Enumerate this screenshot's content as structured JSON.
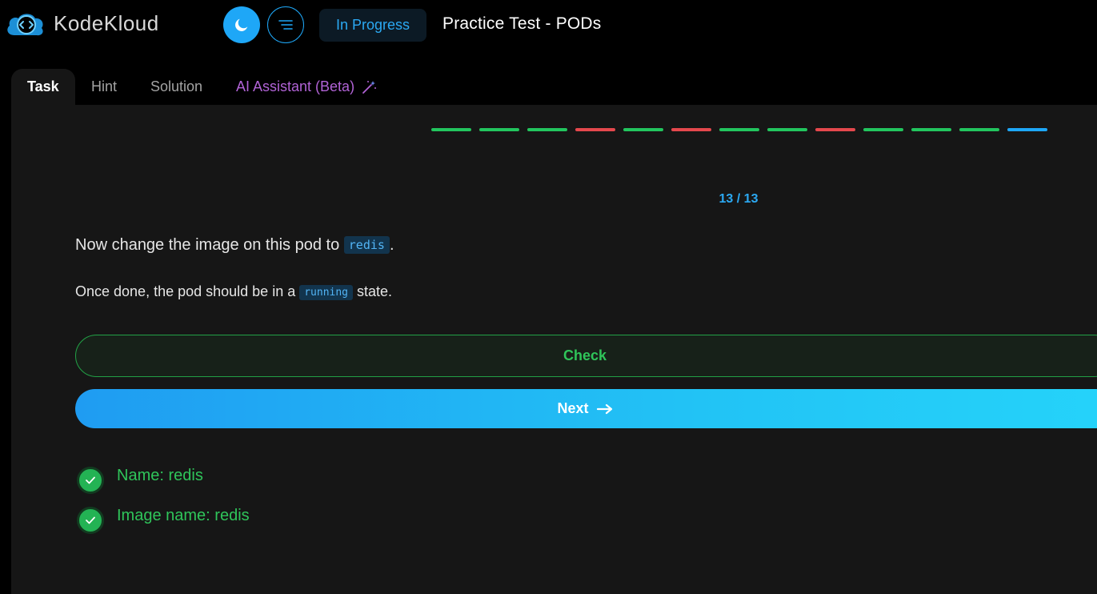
{
  "app": {
    "brand": "KodeKloud",
    "status": "In Progress",
    "title": "Practice Test - PODs"
  },
  "tabs": [
    {
      "label": "Task",
      "active": true
    },
    {
      "label": "Hint",
      "active": false
    },
    {
      "label": "Solution",
      "active": false
    },
    {
      "label": "AI Assistant (Beta)",
      "active": false,
      "icon": "magic-wand-icon"
    }
  ],
  "progress": {
    "segments": [
      "green",
      "green",
      "green",
      "red",
      "green",
      "red",
      "green",
      "green",
      "red",
      "green",
      "green",
      "green",
      "blue"
    ],
    "counter": "13 / 13"
  },
  "question": {
    "line1_prefix": "Now change the image on this pod to ",
    "line1_code": "redis",
    "line1_suffix": ".",
    "line2_prefix": "Once done, the pod should be in a ",
    "line2_code": "running",
    "line2_suffix": " state."
  },
  "buttons": {
    "check": "Check",
    "next": "Next"
  },
  "results": [
    {
      "text": "Name: redis",
      "status": "passed"
    },
    {
      "text": "Image name: redis",
      "status": "passed"
    }
  ],
  "colors": {
    "accent": "#1ea7f7",
    "success": "#2fc55a",
    "fail": "#e5484d",
    "panel": "#161616"
  }
}
